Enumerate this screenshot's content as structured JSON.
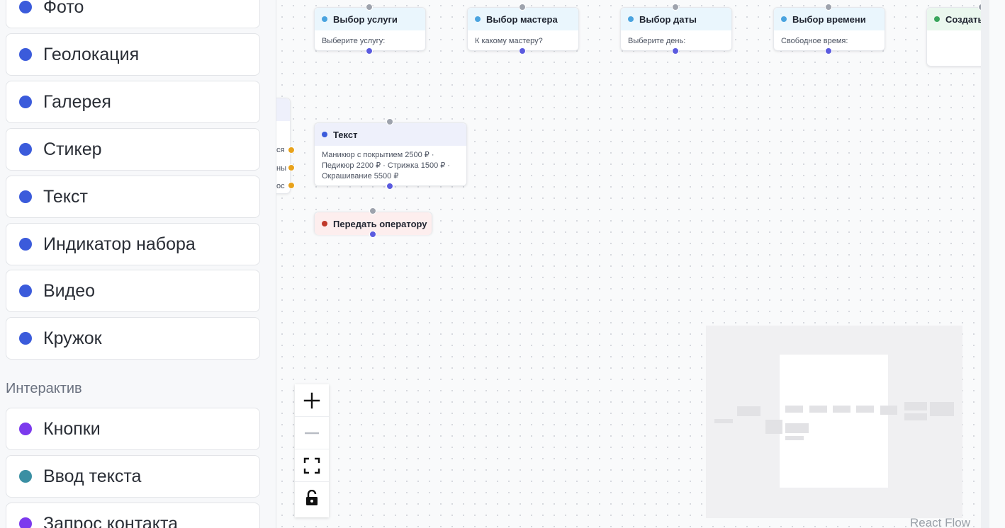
{
  "sidebar": {
    "blocks": [
      {
        "label": "Фото",
        "color": "#3b5bdb"
      },
      {
        "label": "Геолокация",
        "color": "#3b5bdb"
      },
      {
        "label": "Галерея",
        "color": "#3b5bdb"
      },
      {
        "label": "Стикер",
        "color": "#3b5bdb"
      },
      {
        "label": "Текст",
        "color": "#3b5bdb"
      },
      {
        "label": "Индикатор набора",
        "color": "#3b5bdb"
      },
      {
        "label": "Видео",
        "color": "#3b5bdb"
      },
      {
        "label": "Кружок",
        "color": "#3b5bdb"
      }
    ],
    "section_title": "Интерактив",
    "interactive_blocks": [
      {
        "label": "Кнопки",
        "color": "#7c3aed"
      },
      {
        "label": "Ввод текста",
        "color": "#3a8fa3"
      },
      {
        "label": "Запрос контакта",
        "color": "#7c3aed"
      }
    ]
  },
  "canvas": {
    "nodes": {
      "service": {
        "title": "Выбор услуги",
        "body": "Выберите услугу:",
        "color": "#4aa3df"
      },
      "master": {
        "title": "Выбор мастера",
        "body": "К какому мастеру?",
        "color": "#4aa3df"
      },
      "date": {
        "title": "Выбор даты",
        "body": "Выберите день:",
        "color": "#4aa3df"
      },
      "time": {
        "title": "Выбор времени",
        "body": "Свободное время:",
        "color": "#4aa3df"
      },
      "create": {
        "title": "Создать",
        "color": "#3aa55c"
      },
      "text": {
        "title": "Текст",
        "body": "Маникюр с покрытием 2500 ₽ · Педикюр 2200 ₽ · Стрижка 1500 ₽ · Окрашивание 5500 ₽",
        "color": "#3b5bdb"
      },
      "operator": {
        "title": "Передать оператору",
        "color": "#c0392b"
      }
    },
    "partial_node_labels": [
      "ся",
      "ны",
      "ос"
    ],
    "controls": {
      "zoom_in": "plus-icon",
      "zoom_out": "minus-icon",
      "fit_view": "fit-view-icon",
      "lock": "unlock-icon"
    },
    "attribution": "React Flow"
  }
}
